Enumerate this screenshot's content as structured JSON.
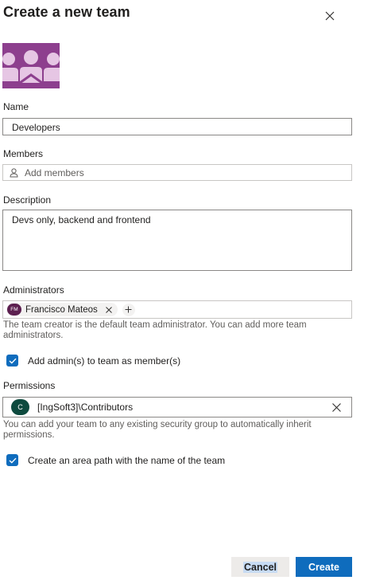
{
  "dialog": {
    "title": "Create a new team",
    "team_icon": "team-group-icon"
  },
  "name": {
    "label": "Name",
    "value": "Developers"
  },
  "members": {
    "label": "Members",
    "placeholder": "Add members",
    "icon": "person-icon"
  },
  "description": {
    "label": "Description",
    "value": "Devs only, backend and frontend"
  },
  "administrators": {
    "label": "Administrators",
    "people": [
      {
        "initials": "FM",
        "name": "Francisco Mateos"
      }
    ],
    "help": "The team creator is the default team administrator. You can add more team administrators.",
    "add_as_member_label": "Add admin(s) to team as member(s)",
    "add_as_member_checked": true
  },
  "permissions": {
    "label": "Permissions",
    "group_initial": "C",
    "group_name": "[IngSoft3]\\Contributors",
    "help": "You can add your team to any existing security group to automatically inherit permissions."
  },
  "area_path": {
    "label": "Create an area path with the name of the team",
    "checked": true
  },
  "footer": {
    "cancel_label": "Cancel",
    "create_label": "Create"
  },
  "colors": {
    "accent": "#0f6cbd",
    "team_tile": "#8d3f8e",
    "admin_avatar": "#5c1f4f",
    "group_avatar": "#0d4a3e"
  }
}
